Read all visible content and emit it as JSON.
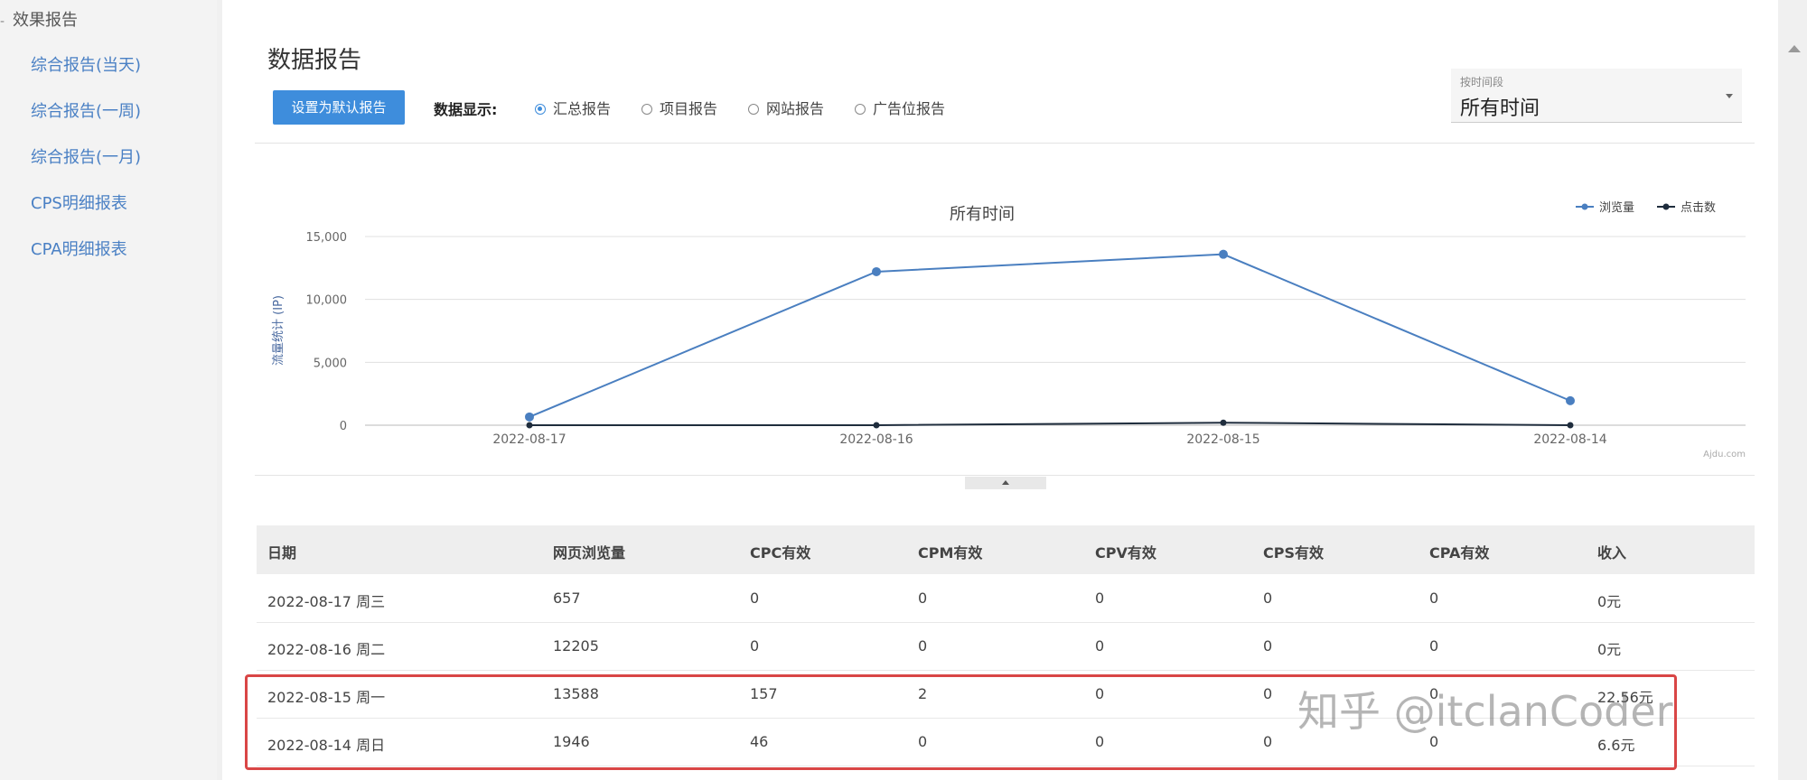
{
  "sidebar": {
    "section": "效果报告",
    "items": [
      {
        "label": "综合报告(当天)"
      },
      {
        "label": "综合报告(一周)"
      },
      {
        "label": "综合报告(一月)"
      },
      {
        "label": "CPS明细报表"
      },
      {
        "label": "CPA明细报表"
      }
    ]
  },
  "page": {
    "title": "数据报告",
    "default_button": "设置为默认报告",
    "display_label": "数据显示:",
    "radios": [
      {
        "label": "汇总报告",
        "checked": true
      },
      {
        "label": "项目报告",
        "checked": false
      },
      {
        "label": "网站报告",
        "checked": false
      },
      {
        "label": "广告位报告",
        "checked": false
      }
    ],
    "time_select": {
      "label": "按时间段",
      "value": "所有时间"
    }
  },
  "chart_data": {
    "type": "line",
    "title": "所有时间",
    "ylabel": "流量统计 (IP)",
    "categories": [
      "2022-08-17",
      "2022-08-16",
      "2022-08-15",
      "2022-08-14"
    ],
    "ylim": [
      0,
      15000
    ],
    "yticks": [
      {
        "value": 0,
        "label": "0"
      },
      {
        "value": 5000,
        "label": "5,000"
      },
      {
        "value": 10000,
        "label": "10,000"
      },
      {
        "value": 15000,
        "label": "15,000"
      }
    ],
    "grid": true,
    "legend_position": "top-right",
    "series": [
      {
        "name": "浏览量",
        "color": "#4a7fc0",
        "values": [
          657,
          12205,
          13588,
          1946
        ]
      },
      {
        "name": "点击数",
        "color": "#1f2d3d",
        "values": [
          0,
          0,
          200,
          0
        ]
      }
    ],
    "credit": "Ajdu.com"
  },
  "table": {
    "headers": [
      "日期",
      "网页浏览量",
      "CPC有效",
      "CPM有效",
      "CPV有效",
      "CPS有效",
      "CPA有效",
      "收入"
    ],
    "rows": [
      [
        "2022-08-17 周三",
        "657",
        "0",
        "0",
        "0",
        "0",
        "0",
        "0元"
      ],
      [
        "2022-08-16 周二",
        "12205",
        "0",
        "0",
        "0",
        "0",
        "0",
        "0元"
      ],
      [
        "2022-08-15 周一",
        "13588",
        "157",
        "2",
        "0",
        "0",
        "0",
        "22.56元"
      ],
      [
        "2022-08-14 周日",
        "1946",
        "46",
        "0",
        "0",
        "0",
        "0",
        "6.6元"
      ]
    ]
  },
  "watermark": "知乎 @itclanCoder"
}
